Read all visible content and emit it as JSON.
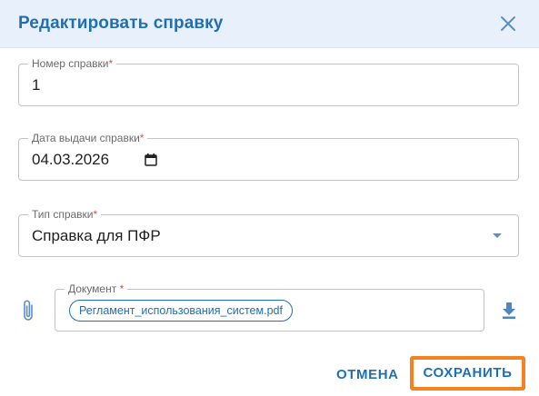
{
  "dialog": {
    "title": "Редактировать справку",
    "close_icon": "close-icon"
  },
  "fields": {
    "number": {
      "label": "Номер справки",
      "required_mark": "*",
      "value": "1"
    },
    "issue_date": {
      "label": "Дата выдачи справки",
      "required_mark": "*",
      "value": "04.03.2026",
      "icon": "calendar-icon"
    },
    "type": {
      "label": "Тип справки",
      "required_mark": "*",
      "value": "Справка для ПФР",
      "icon": "chevron-down-icon"
    },
    "document": {
      "label": "Документ",
      "required_mark": "*",
      "file_name": "Регламент_использования_систем.pdf",
      "attach_icon": "paperclip-icon",
      "download_icon": "download-icon"
    }
  },
  "actions": {
    "cancel_label": "ОТМЕНА",
    "save_label": "СОХРАНИТЬ"
  },
  "colors": {
    "accent": "#1f6fb5",
    "header_bg": "#e8f1fb",
    "required": "#e5484d",
    "highlight": "#f58220"
  }
}
